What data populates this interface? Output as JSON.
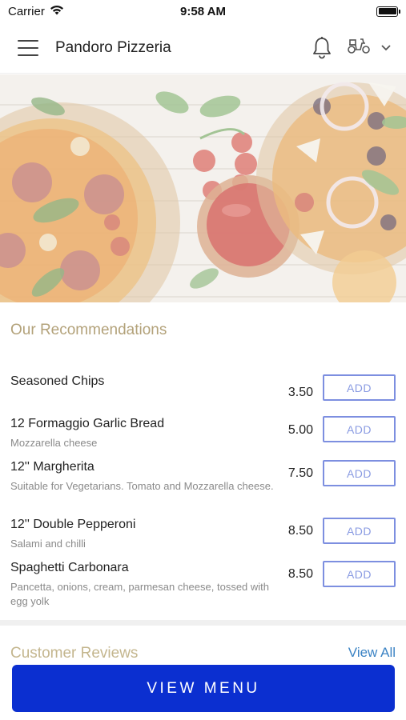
{
  "status_bar": {
    "carrier": "Carrier",
    "time": "9:58 AM"
  },
  "header": {
    "title": "Pandoro Pizzeria",
    "icons": [
      "menu-icon",
      "bell-icon",
      "scooter-icon",
      "chevron-down-icon"
    ]
  },
  "hero": {
    "image": "pizza-hero-image"
  },
  "recommendations": {
    "title": "Our Recommendations",
    "items": [
      {
        "name": "Seasoned Chips",
        "description": "",
        "price": "3.50",
        "add_label": "ADD"
      },
      {
        "name": "12 Formaggio Garlic Bread",
        "description": "Mozzarella cheese",
        "price": "5.00",
        "add_label": "ADD"
      },
      {
        "name": "12'' Margherita",
        "description": "Suitable for Vegetarians. Tomato and Mozzarella cheese.",
        "price": "7.50",
        "add_label": "ADD"
      },
      {
        "name": "12'' Double Pepperoni",
        "description": "Salami and chilli",
        "price": "8.50",
        "add_label": "ADD"
      },
      {
        "name": "Spaghetti Carbonara",
        "description": "Pancetta, onions, cream, parmesan cheese, tossed with egg yolk",
        "price": "8.50",
        "add_label": "ADD"
      }
    ]
  },
  "reviews": {
    "title": "Customer Reviews",
    "view_all": "View All"
  },
  "footer": {
    "view_menu": "VIEW MENU"
  },
  "colors": {
    "accent_gold": "#b3a27a",
    "add_border": "#7d8fe0",
    "primary_button": "#0b2fd0",
    "link": "#3b83c4"
  }
}
